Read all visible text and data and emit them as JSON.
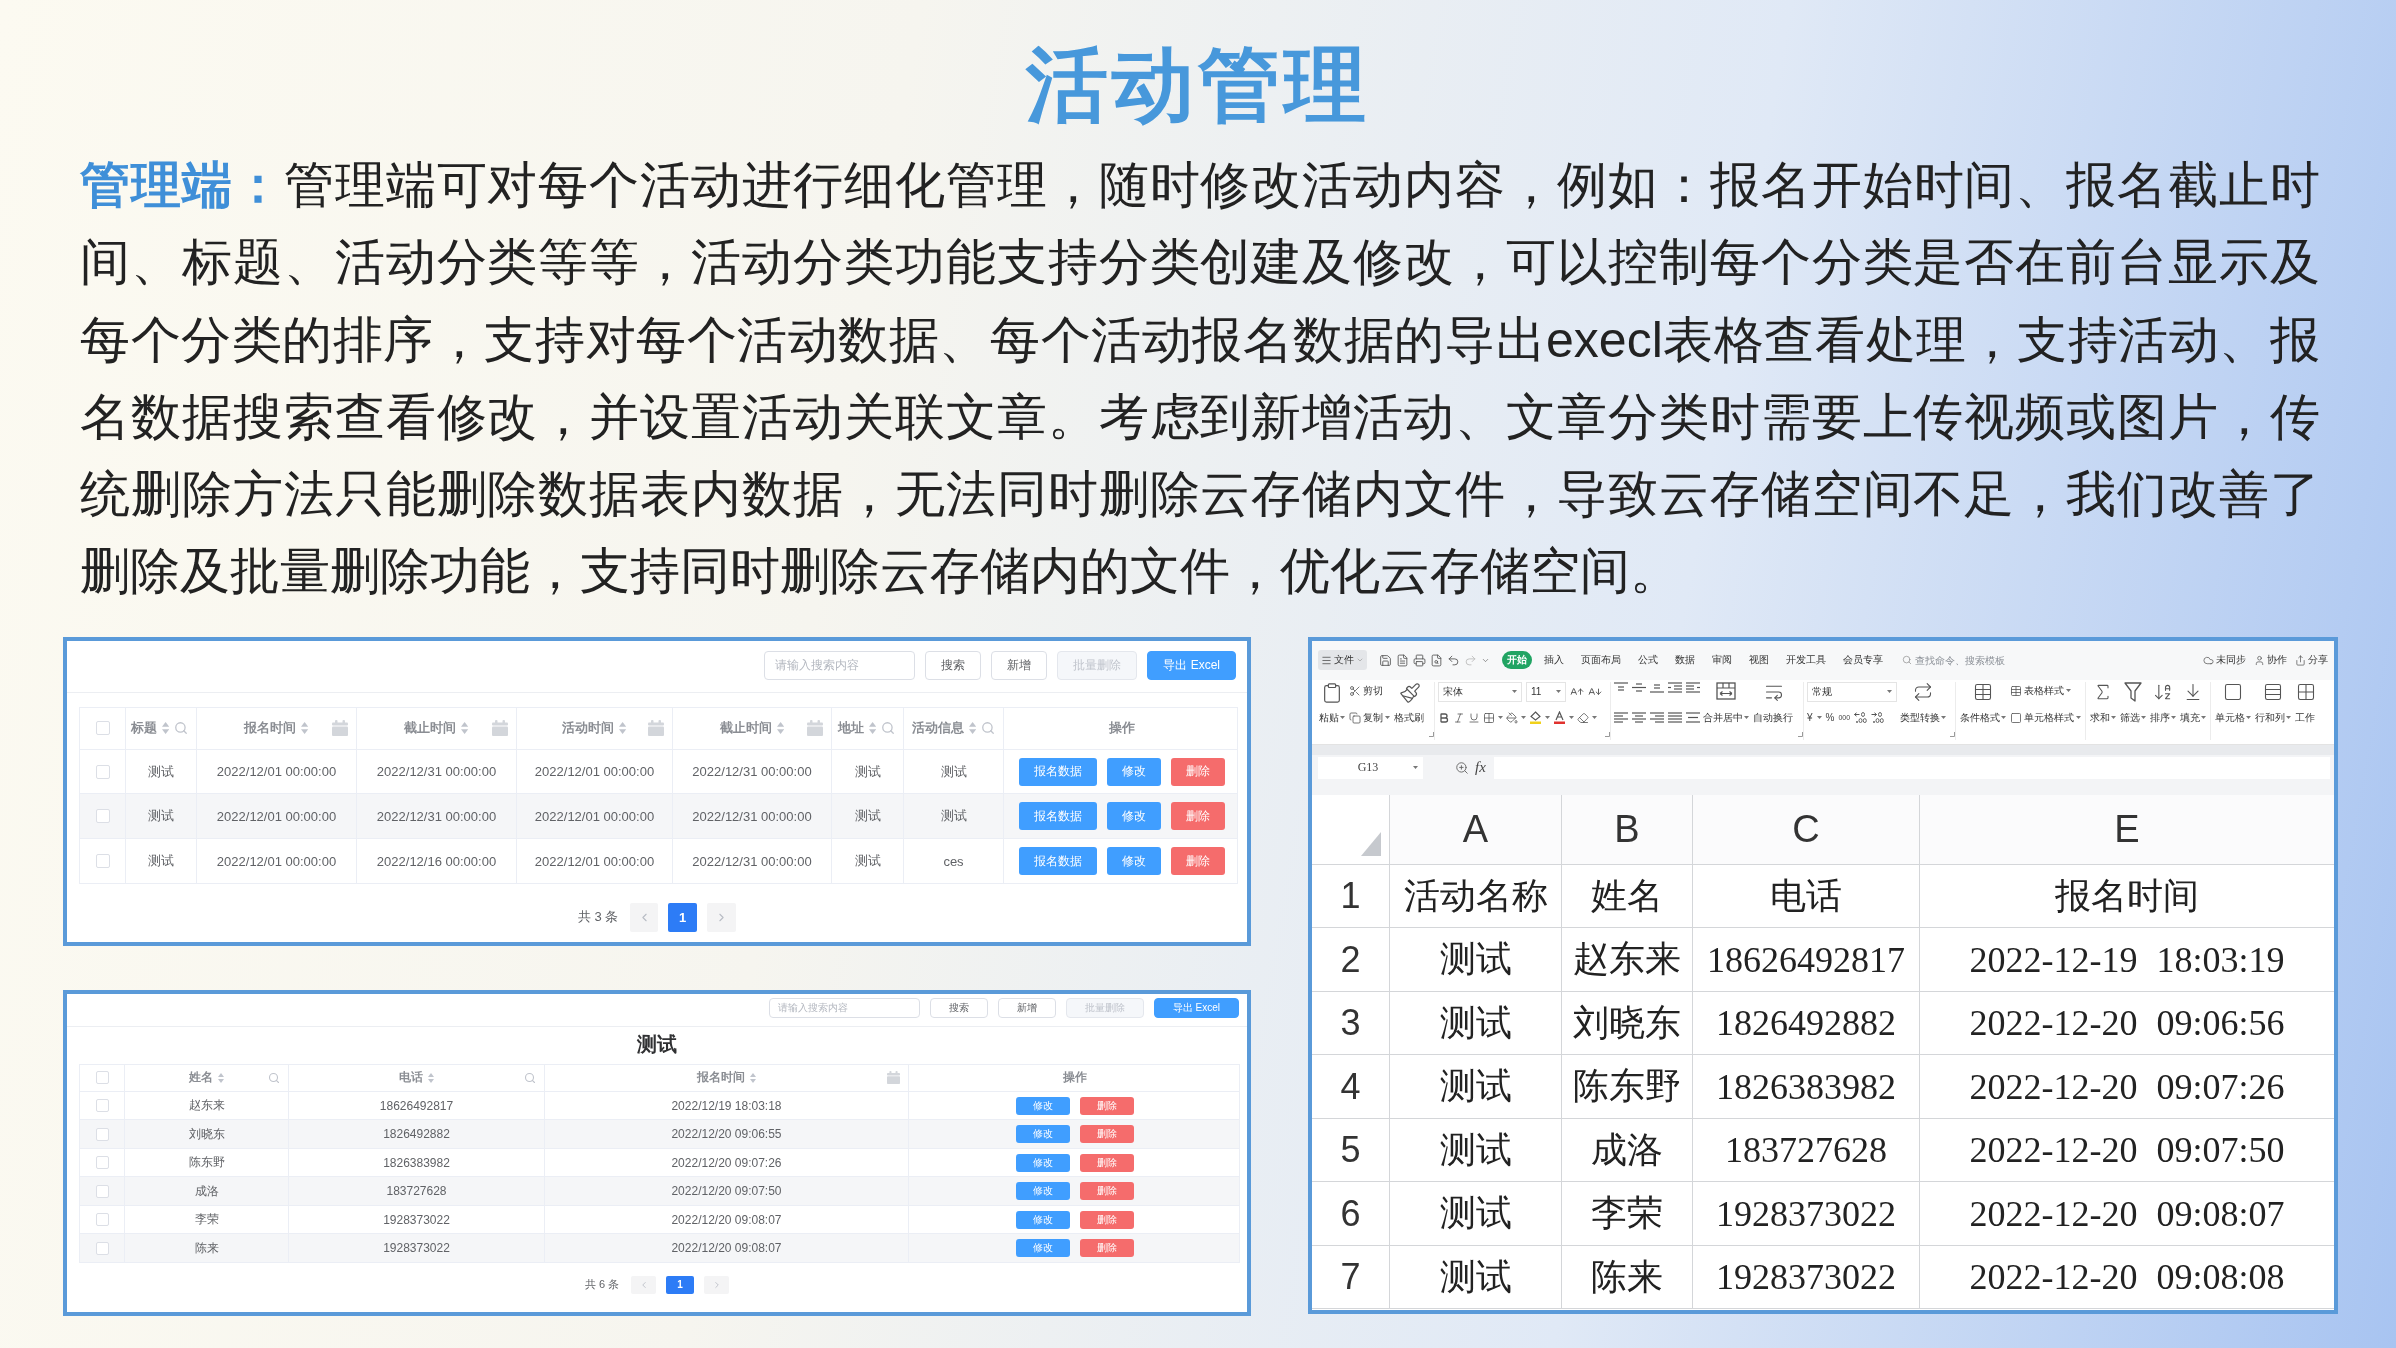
{
  "title": "活动管理",
  "description": "**管理端：**管理端可对每个活动进行细化管理，随时修改活动内容，例如：报名开始时间、报名截止时间、标题、活动分类等等，活动分类功能支持分类创建及修改，可以控制每个分类是否在前台显示及每个分类的排序，支持对每个活动数据、每个活动报名数据的导出execl表格查看处理，支持活动、报名数据搜索查看修改，并设置活动关联文章。考虑到新增活动、文章分类时需要上传视频或图片，传统删除方法只能删除数据表内数据，无法同时删除云存储内文件，导致云存储空间不足，我们改善了删除及批量删除功能，支持同时删除云存储内的文件，优化云存储空间。",
  "activity_admin": {
    "search": {
      "placeholder": "请输入搜索内容"
    },
    "toolbar_buttons": [
      {
        "label": "搜索",
        "kind": "default",
        "disabled": false
      },
      {
        "label": "新增",
        "kind": "default",
        "disabled": false
      },
      {
        "label": "批量删除",
        "kind": "default",
        "disabled": true
      },
      {
        "label": "导出 Excel",
        "kind": "primary",
        "disabled": false
      }
    ],
    "select_all": {
      "checked": false
    },
    "columns": [
      {
        "label": "标题",
        "sortable": true,
        "kind": "search"
      },
      {
        "label": "报名时间",
        "sortable": true,
        "kind": "date"
      },
      {
        "label": "截止时间",
        "sortable": true,
        "kind": "date"
      },
      {
        "label": "活动时间",
        "sortable": true,
        "kind": "date"
      },
      {
        "label": "截止时间",
        "sortable": true,
        "kind": "date"
      },
      {
        "label": "地址",
        "sortable": true,
        "kind": "search"
      },
      {
        "label": "活动信息",
        "sortable": true,
        "kind": "search"
      },
      {
        "label": "操作",
        "sortable": false,
        "kind": "plain"
      }
    ],
    "rows": [
      {
        "checked": false,
        "cells": [
          "测试",
          "2022/12/01 00:00:00",
          "2022/12/31 00:00:00",
          "2022/12/01 00:00:00",
          "2022/12/31 00:00:00",
          "测试",
          "测试"
        ],
        "actions": [
          {
            "label": "报名数据",
            "kind": "primary"
          },
          {
            "label": "修改",
            "kind": "primary"
          },
          {
            "label": "删除",
            "kind": "danger"
          }
        ]
      },
      {
        "checked": false,
        "cells": [
          "测试",
          "2022/12/01 00:00:00",
          "2022/12/31 00:00:00",
          "2022/12/01 00:00:00",
          "2022/12/31 00:00:00",
          "测试",
          "测试"
        ],
        "actions": [
          {
            "label": "报名数据",
            "kind": "primary"
          },
          {
            "label": "修改",
            "kind": "primary"
          },
          {
            "label": "删除",
            "kind": "danger"
          }
        ]
      },
      {
        "checked": false,
        "cells": [
          "测试",
          "2022/12/01 00:00:00",
          "2022/12/16 00:00:00",
          "2022/12/01 00:00:00",
          "2022/12/31 00:00:00",
          "测试",
          "ces"
        ],
        "actions": [
          {
            "label": "报名数据",
            "kind": "primary"
          },
          {
            "label": "修改",
            "kind": "primary"
          },
          {
            "label": "删除",
            "kind": "danger"
          }
        ]
      }
    ],
    "pagination": {
      "total": "共 3 条",
      "pages": [
        {
          "label": "1",
          "selected": true
        }
      ]
    }
  },
  "signup_data": {
    "search": {
      "placeholder": "请输入搜索内容"
    },
    "toolbar_buttons": [
      {
        "label": "搜索",
        "kind": "default",
        "disabled": false
      },
      {
        "label": "新增",
        "kind": "default",
        "disabled": false
      },
      {
        "label": "批量删除",
        "kind": "default",
        "disabled": true
      },
      {
        "label": "导出 Excel",
        "kind": "primary",
        "disabled": false
      }
    ],
    "title": "测试",
    "select_all": {
      "checked": false
    },
    "columns": [
      {
        "label": "姓名",
        "sortable": true,
        "kind": "search"
      },
      {
        "label": "电话",
        "sortable": true,
        "kind": "search"
      },
      {
        "label": "报名时间",
        "sortable": true,
        "kind": "date"
      },
      {
        "label": "操作",
        "sortable": false,
        "kind": "plain"
      }
    ],
    "rows": [
      {
        "checked": false,
        "cells": [
          "赵东来",
          "18626492817",
          "2022/12/19 18:03:18"
        ],
        "actions": [
          {
            "label": "修改",
            "kind": "primary"
          },
          {
            "label": "删除",
            "kind": "danger"
          }
        ]
      },
      {
        "checked": false,
        "cells": [
          "刘晓东",
          "1826492882",
          "2022/12/20 09:06:55"
        ],
        "actions": [
          {
            "label": "修改",
            "kind": "primary"
          },
          {
            "label": "删除",
            "kind": "danger"
          }
        ]
      },
      {
        "checked": false,
        "cells": [
          "陈东野",
          "1826383982",
          "2022/12/20 09:07:26"
        ],
        "actions": [
          {
            "label": "修改",
            "kind": "primary"
          },
          {
            "label": "删除",
            "kind": "danger"
          }
        ]
      },
      {
        "checked": false,
        "cells": [
          "成洛",
          "183727628",
          "2022/12/20 09:07:50"
        ],
        "actions": [
          {
            "label": "修改",
            "kind": "primary"
          },
          {
            "label": "删除",
            "kind": "danger"
          }
        ]
      },
      {
        "checked": false,
        "cells": [
          "李荣",
          "1928373022",
          "2022/12/20 09:08:07"
        ],
        "actions": [
          {
            "label": "修改",
            "kind": "primary"
          },
          {
            "label": "删除",
            "kind": "danger"
          }
        ]
      },
      {
        "checked": false,
        "cells": [
          "陈来",
          "1928373022",
          "2022/12/20 09:08:07"
        ],
        "actions": [
          {
            "label": "修改",
            "kind": "primary"
          },
          {
            "label": "删除",
            "kind": "danger"
          }
        ]
      }
    ],
    "pagination": {
      "total": "共 6 条",
      "pages": [
        {
          "label": "1",
          "selected": true
        }
      ]
    }
  },
  "spreadsheet": {
    "file_menu": "文件",
    "tabs": [
      {
        "label": "开始",
        "selected": true
      },
      {
        "label": "插入",
        "selected": false
      },
      {
        "label": "页面布局",
        "selected": false
      },
      {
        "label": "公式",
        "selected": false
      },
      {
        "label": "数据",
        "selected": false
      },
      {
        "label": "审阅",
        "selected": false
      },
      {
        "label": "视图",
        "selected": false
      },
      {
        "label": "开发工具",
        "selected": false
      },
      {
        "label": "会员专享",
        "selected": false
      }
    ],
    "command_search": {
      "placeholder": "查找命令、搜索模板"
    },
    "cloud_actions": [
      "未同步",
      "协作",
      "分享"
    ],
    "ribbon": [
      {
        "kind": "large",
        "label": "粘贴",
        "dropdown": true
      },
      {
        "kind": "stack",
        "items": [
          {
            "label": "剪切",
            "dropdown": false
          },
          {
            "label": "复制",
            "dropdown": true
          }
        ]
      },
      {
        "kind": "large",
        "label": "格式刷",
        "dropdown": false
      },
      {
        "kind": "font",
        "font_name": "宋体",
        "font_size": "11"
      },
      {
        "kind": "align"
      },
      {
        "kind": "large",
        "label": "合并居中",
        "dropdown": true
      },
      {
        "kind": "large",
        "label": "自动换行",
        "dropdown": false
      },
      {
        "kind": "number",
        "format": "常规",
        "symbols": [
          "¥",
          "%",
          "000"
        ]
      },
      {
        "kind": "large",
        "label": "类型转换",
        "dropdown": true
      },
      {
        "kind": "large",
        "label": "条件格式",
        "dropdown": true
      },
      {
        "kind": "stack",
        "items": [
          {
            "label": "表格样式",
            "dropdown": true
          },
          {
            "label": "单元格样式",
            "dropdown": true
          }
        ]
      },
      {
        "kind": "large",
        "label": "求和",
        "dropdown": true
      },
      {
        "kind": "large",
        "label": "筛选",
        "dropdown": true
      },
      {
        "kind": "large",
        "label": "排序",
        "dropdown": true
      },
      {
        "kind": "large",
        "label": "填充",
        "dropdown": true
      },
      {
        "kind": "large",
        "label": "单元格",
        "dropdown": true
      },
      {
        "kind": "large",
        "label": "行和列",
        "dropdown": true
      },
      {
        "kind": "large",
        "label": "工作",
        "dropdown": false
      }
    ],
    "name_box": "G13",
    "formula_label": "fx",
    "column_headers": [
      "A",
      "B",
      "C",
      "E"
    ],
    "rows": [
      {
        "number": "1",
        "cells": [
          "活动名称",
          "姓名",
          "电话",
          "报名时间"
        ]
      },
      {
        "number": "2",
        "cells": [
          "测试",
          "赵东来",
          "18626492817",
          "2022-12-19 18:03:19"
        ]
      },
      {
        "number": "3",
        "cells": [
          "测试",
          "刘晓东",
          "1826492882",
          "2022-12-20 09:06:56"
        ]
      },
      {
        "number": "4",
        "cells": [
          "测试",
          "陈东野",
          "1826383982",
          "2022-12-20 09:07:26"
        ]
      },
      {
        "number": "5",
        "cells": [
          "测试",
          "成洛",
          "183727628",
          "2022-12-20 09:07:50"
        ]
      },
      {
        "number": "6",
        "cells": [
          "测试",
          "李荣",
          "1928373022",
          "2022-12-20 09:08:07"
        ]
      },
      {
        "number": "7",
        "cells": [
          "测试",
          "陈来",
          "1928373022",
          "2022-12-20 09:08:08"
        ]
      }
    ]
  }
}
